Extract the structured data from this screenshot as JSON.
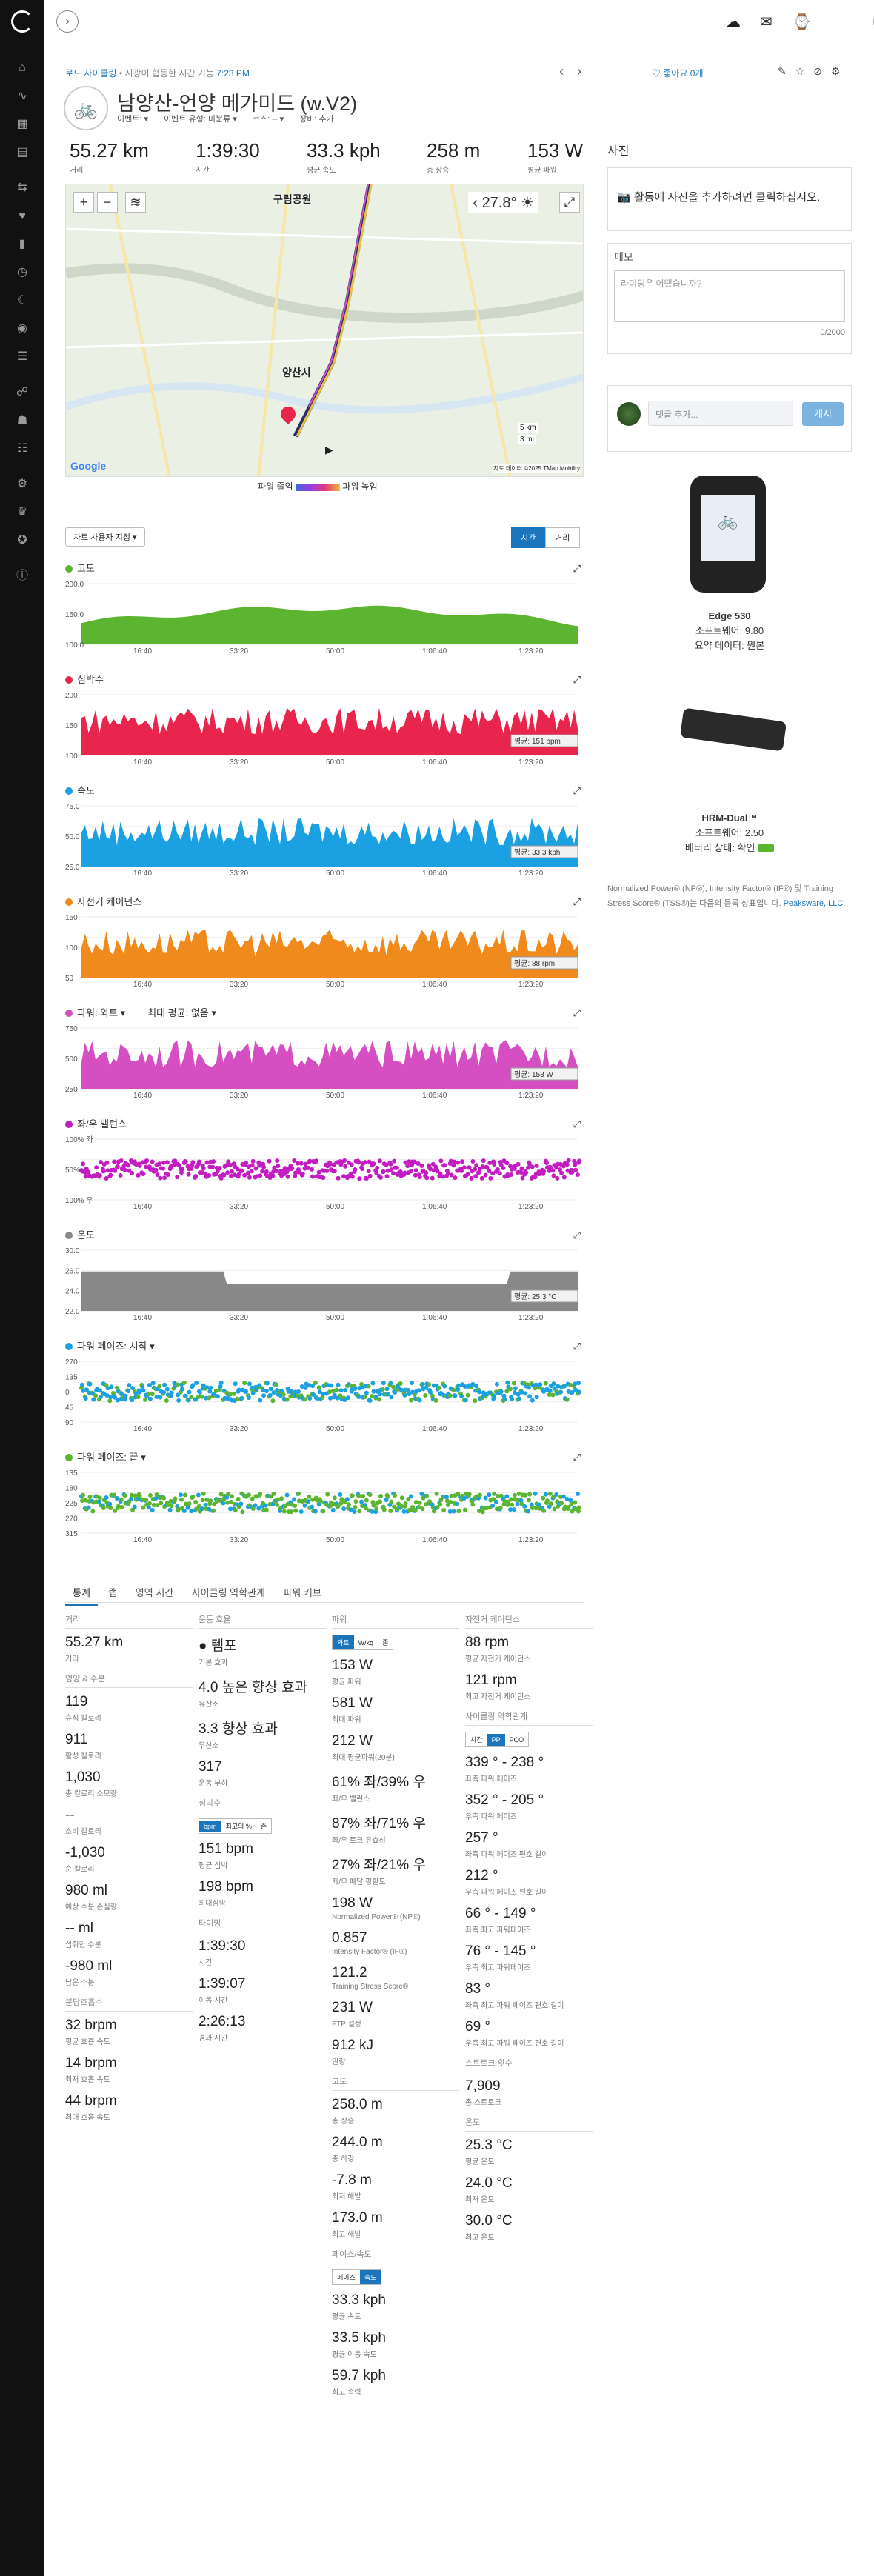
{
  "topbar": {
    "back": "›",
    "icons": [
      "cloud-upload-icon",
      "inbox-icon",
      "watch-icon"
    ]
  },
  "breadcrumb": {
    "prefix": "로드 사이클링",
    "sep": "•",
    "date": "시광이 협동한 시간 기능",
    "time": "7:23 PM"
  },
  "header": {
    "like": "좋아요 0개",
    "title": "남양산-언양 메가미드 (w.V2)",
    "sub": [
      "이벤트: ▾",
      "이벤트 유형: 미분류 ▾",
      "코스: -- ▾",
      "장비: 추가"
    ]
  },
  "stats": [
    {
      "value": "55.27 km",
      "label": "거리"
    },
    {
      "value": "1:39:30",
      "label": "시간"
    },
    {
      "value": "33.3 kph",
      "label": "평균 속도"
    },
    {
      "value": "258 m",
      "label": "총 상승"
    },
    {
      "value": "153 W",
      "label": "평균 파워"
    }
  ],
  "map": {
    "temp": "27.8°",
    "town": "양산시",
    "town2": "구림공원",
    "legend_left": "파워 줄임",
    "legend_right": "파워 높임",
    "attribution": "지도 데이터 ©2025 TMap Mobility",
    "scale_km": "5 km",
    "scale_mi": "3 mi",
    "logo": "Google"
  },
  "chart_controls": {
    "select": "차트 사용자 지정 ▾",
    "toggle": [
      "시간",
      "거리"
    ]
  },
  "charts": [
    {
      "name": "elevation",
      "title": "고도",
      "color": "#5cb531",
      "ylabels": [
        "200.0",
        "150.0",
        "100.0"
      ],
      "avg": ""
    },
    {
      "name": "heart-rate",
      "title": "심박수",
      "color": "#e8264d",
      "ylabels": [
        "200",
        "150",
        "100"
      ],
      "avg": "평균: 151 bpm"
    },
    {
      "name": "speed",
      "title": "속도",
      "color": "#1ba1e2",
      "ylabels": [
        "75.0",
        "50.0",
        "25.0"
      ],
      "avg": "평균: 33.3 kph"
    },
    {
      "name": "cadence",
      "title": "자전거 케이던스",
      "color": "#f08a1c",
      "ylabels": [
        "150",
        "100",
        "50"
      ],
      "avg": "평균: 88 rpm"
    },
    {
      "name": "power",
      "title": "파워: 와트 ▾",
      "extra": "최대 평균: 없음 ▾",
      "color": "#d64fc2",
      "ylabels": [
        "750",
        "500",
        "250"
      ],
      "avg": "평균: 153 W"
    },
    {
      "name": "lr-balance",
      "title": "좌/우 밸런스",
      "color": "#c21cc2",
      "ylabels": [
        "100% 좌",
        "50%",
        "100% 우"
      ],
      "avg": ""
    },
    {
      "name": "temperature",
      "title": "온도",
      "color": "#888888",
      "ylabels": [
        "30.0",
        "26.0",
        "24.0",
        "22.0"
      ],
      "avg": "평균: 25.3 °C"
    },
    {
      "name": "power-phase-start",
      "title": "파워 페이즈: 시작 ▾",
      "color": "#1ba1e2",
      "ylabels": [
        "270",
        "135",
        "0",
        "45",
        "90"
      ],
      "avg": ""
    },
    {
      "name": "power-phase-end",
      "title": "파워 페이즈: 끝 ▾",
      "color": "#5cb531",
      "ylabels": [
        "135",
        "180",
        "225",
        "270",
        "315"
      ],
      "avg": ""
    }
  ],
  "xticks": [
    "16:40",
    "33:20",
    "50:00",
    "1:06:40",
    "1:23:20"
  ],
  "stat_tabs": [
    "통계",
    "랩",
    "영역 시간",
    "사이클링 역학관계",
    "파워 커브"
  ],
  "col1": {
    "sections": [
      {
        "h": "거리",
        "items": [
          {
            "v": "55.27 km",
            "l": "거리"
          }
        ]
      },
      {
        "h": "영양 & 수분",
        "items": [
          {
            "v": "119",
            "l": "휴식 칼로리"
          },
          {
            "v": "911",
            "l": "활성 칼로리"
          },
          {
            "v": "1,030",
            "l": "총 칼로리 소모량"
          },
          {
            "v": "--",
            "l": "소비 칼로리"
          },
          {
            "v": "-1,030",
            "l": "순 칼로리"
          },
          {
            "v": "980 ml",
            "l": "예상 수분 손실량"
          },
          {
            "v": "-- ml",
            "l": "섭취한 수분"
          },
          {
            "v": "-980 ml",
            "l": "남은 수분"
          }
        ]
      },
      {
        "h": "분당호흡수",
        "items": [
          {
            "v": "32 brpm",
            "l": "평균 호흡 속도"
          },
          {
            "v": "14 brpm",
            "l": "최저 호흡 속도"
          },
          {
            "v": "44 brpm",
            "l": "최대 호흡 속도"
          }
        ]
      }
    ]
  },
  "col2": {
    "sections": [
      {
        "h": "운동 효율",
        "items": [
          {
            "v": "● 템포",
            "l": "기본 효과"
          },
          {
            "v": "4.0 높은 향상 효과",
            "l": "유산소"
          },
          {
            "v": "3.3 향상 효과",
            "l": "무산소"
          },
          {
            "v": "317",
            "l": "운동 부하"
          }
        ]
      },
      {
        "h": "심박수",
        "seg": [
          "bpm",
          "최고의 %",
          "존"
        ],
        "items": [
          {
            "v": "151 bpm",
            "l": "평균 심박"
          },
          {
            "v": "198 bpm",
            "l": "최대심박"
          }
        ]
      },
      {
        "h": "타이밍",
        "items": [
          {
            "v": "1:39:30",
            "l": "시간"
          },
          {
            "v": "1:39:07",
            "l": "이동 시간"
          },
          {
            "v": "2:26:13",
            "l": "경과 시간"
          }
        ]
      }
    ]
  },
  "col3": {
    "sections": [
      {
        "h": "파워",
        "seg": [
          "와트",
          "W/kg",
          "존"
        ],
        "items": [
          {
            "v": "153 W",
            "l": "평균 파워"
          },
          {
            "v": "581 W",
            "l": "최대 파워"
          },
          {
            "v": "212 W",
            "l": "최대 평균파워(20분)"
          },
          {
            "v": "61% 좌/39% 우",
            "l": "좌/우 밸런스"
          },
          {
            "v": "87% 좌/71% 우",
            "l": "좌/우 토크 유효성"
          },
          {
            "v": "27% 좌/21% 우",
            "l": "좌/우 페달 평활도"
          },
          {
            "v": "198 W",
            "l": "Normalized Power® (NP®)"
          },
          {
            "v": "0.857",
            "l": "Intensity Factor® (IF®)"
          },
          {
            "v": "121.2",
            "l": "Training Stress Score®"
          },
          {
            "v": "231 W",
            "l": "FTP 설정"
          },
          {
            "v": "912 kJ",
            "l": "일량"
          }
        ]
      },
      {
        "h": "고도",
        "items": [
          {
            "v": "258.0 m",
            "l": "총 상승"
          },
          {
            "v": "244.0 m",
            "l": "총 하강"
          },
          {
            "v": "-7.8 m",
            "l": "최저 해발"
          },
          {
            "v": "173.0 m",
            "l": "최고 해발"
          }
        ]
      },
      {
        "h": "페이스/속도",
        "seg": [
          "페이스",
          "속도"
        ],
        "items": [
          {
            "v": "33.3 kph",
            "l": "평균 속도"
          },
          {
            "v": "33.5 kph",
            "l": "평균 이동 속도"
          },
          {
            "v": "59.7 kph",
            "l": "최고 속력"
          }
        ]
      }
    ]
  },
  "col4": {
    "sections": [
      {
        "h": "자전거 케이던스",
        "items": [
          {
            "v": "88 rpm",
            "l": "평균 자전거 케이던스"
          },
          {
            "v": "121 rpm",
            "l": "최고 자전거 케이던스"
          }
        ]
      },
      {
        "h": "사이클링 역학관계",
        "seg": [
          "시간",
          "PP",
          "PCO"
        ],
        "items": [
          {
            "v": "339 ° - 238 °",
            "l": "좌측 파워 페이즈"
          },
          {
            "v": "352 ° - 205 °",
            "l": "우측 파워 페이즈"
          },
          {
            "v": "257 °",
            "l": "좌측 파워 페이즈 편호 길이"
          },
          {
            "v": "212 °",
            "l": "우측 파워 페이즈 편호 길이"
          },
          {
            "v": "66 ° - 149 °",
            "l": "좌측 최고 파워페이즈"
          },
          {
            "v": "76 ° - 145 °",
            "l": "우측 최고 파워페이즈"
          },
          {
            "v": "83 °",
            "l": "좌측 최고 파워 페이즈 편호 길이"
          },
          {
            "v": "69 °",
            "l": "우측 최고 파워 페이즈 편호 길이"
          }
        ]
      },
      {
        "h": "스트로크 횟수",
        "items": [
          {
            "v": "7,909",
            "l": "총 스트로크"
          }
        ]
      },
      {
        "h": "온도",
        "items": [
          {
            "v": "25.3 °C",
            "l": "평균 온도"
          },
          {
            "v": "24.0 °C",
            "l": "최저 온도"
          },
          {
            "v": "30.0 °C",
            "l": "최고 온도"
          }
        ]
      }
    ]
  },
  "right": {
    "photos_h": "사진",
    "photos_text": "활동에 사진을 추가하려면 클릭하십시오.",
    "notes_h": "메모",
    "notes_ph": "라이딩은 어땠습니까?",
    "notes_count": "0/2000",
    "comment_ph": "댓글 추가...",
    "comment_btn": "게시",
    "devices": [
      {
        "name": "Edge 530",
        "l1": "소프트웨어: 9.80",
        "l2": "요약 데이터: 원본"
      },
      {
        "name": "HRM-Dual™",
        "l1": "소프트웨어: 2.50",
        "l2": "배터리 상태: 확인"
      }
    ],
    "np_note": "Normalized Power® (NP®), Intensity Factor® (IF®) 및 Training Stress Score® (TSS®)는 다음의 등록 상표입니다.",
    "np_link": "Peaksware, LLC."
  }
}
